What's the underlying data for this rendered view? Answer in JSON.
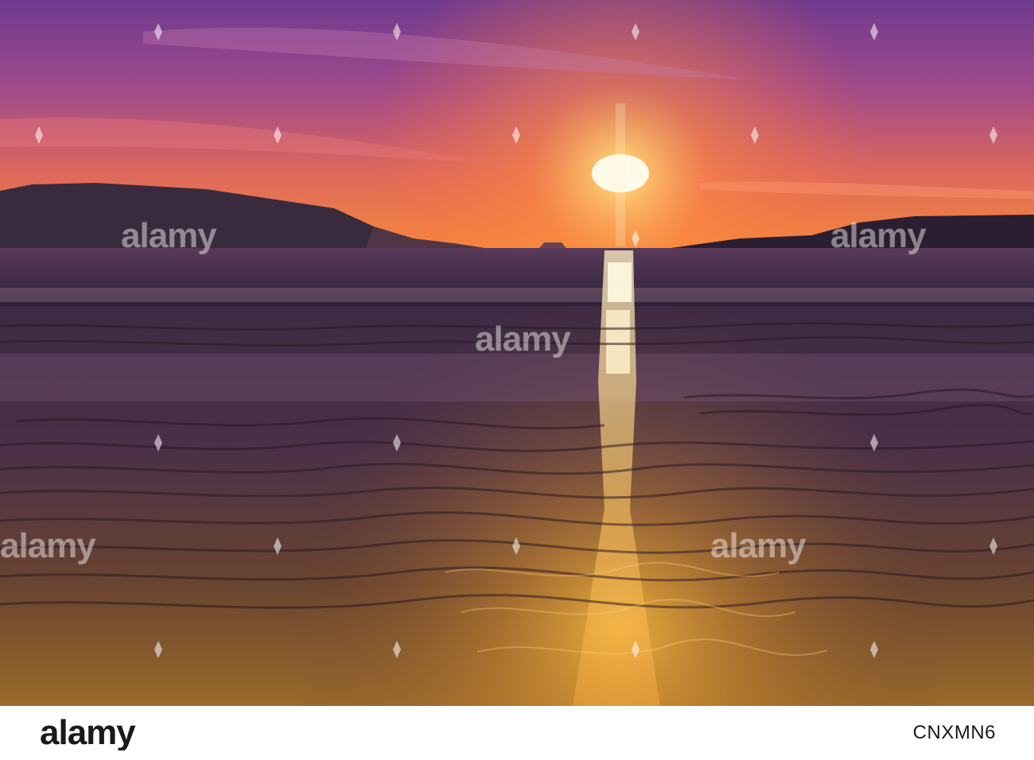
{
  "watermark": {
    "text": "alamy"
  },
  "footer": {
    "brand": "alamy",
    "image_id": "CNXMN6"
  },
  "colors": {
    "sky_top": "#7a3a8c",
    "sky_horizon": "#f07a3a",
    "sun": "#fff6d8",
    "sea": "#3a2a4a",
    "sand": "#c78a2a"
  }
}
